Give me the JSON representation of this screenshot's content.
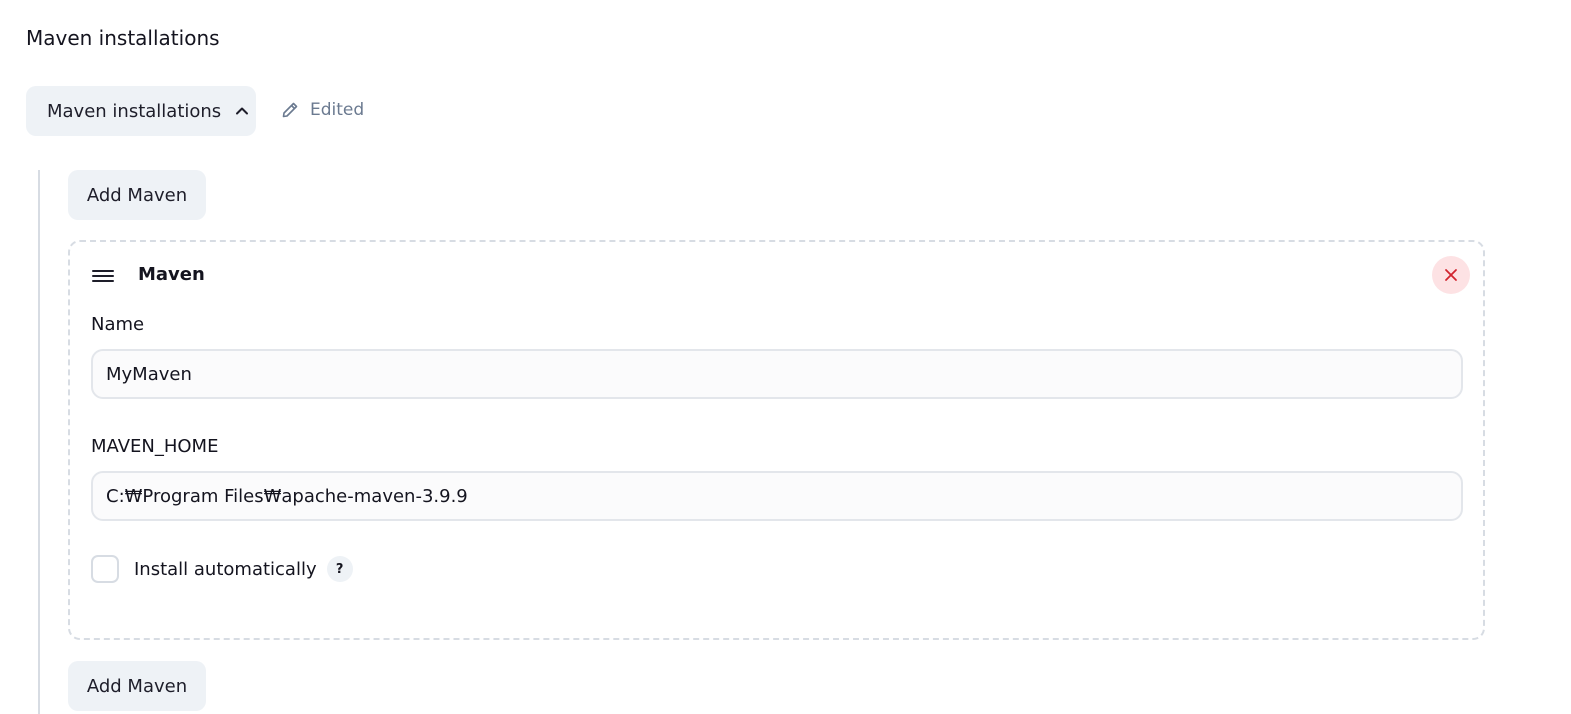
{
  "section": {
    "title": "Maven installations"
  },
  "toggle": {
    "label": "Maven installations",
    "icon": "chevron-up-icon"
  },
  "status": {
    "label": "Edited",
    "icon": "pencil-icon",
    "color": "#6b7a90"
  },
  "actions": {
    "add_top_label": "Add Maven",
    "add_bottom_label": "Add Maven"
  },
  "installation": {
    "title": "Maven",
    "drag_icon": "drag-handle-icon",
    "delete_icon": "close-icon",
    "delete_color": "#d1242f",
    "name_label": "Name",
    "name_value": "MyMaven",
    "home_label": "MAVEN_HOME",
    "home_value": "C:₩Program Files₩apache-maven-3.9.9",
    "install_auto_label": "Install automatically",
    "install_auto_checked": false,
    "help_label": "?"
  }
}
